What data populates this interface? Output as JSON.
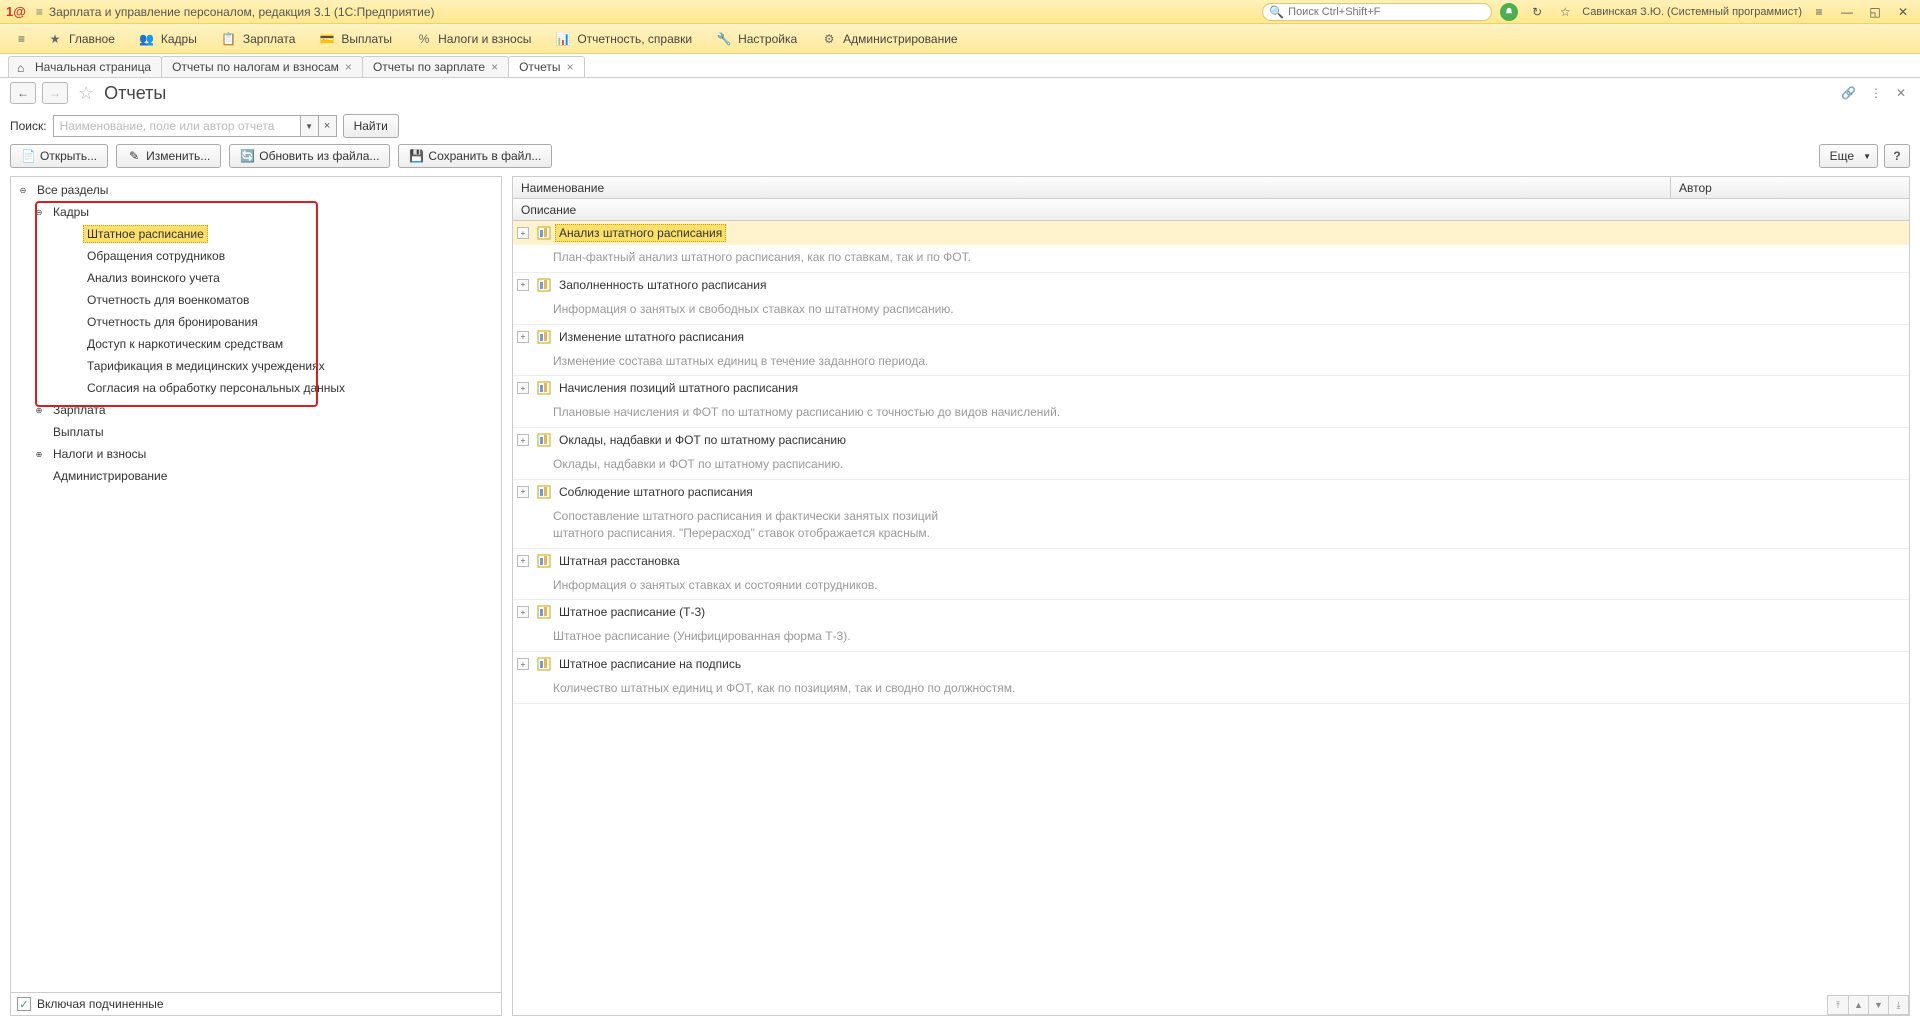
{
  "titlebar": {
    "app_title": "Зарплата и управление персоналом, редакция 3.1  (1С:Предприятие)",
    "search_placeholder": "Поиск Ctrl+Shift+F",
    "user": "Савинская З.Ю. (Системный программист)"
  },
  "mainmenu": [
    {
      "label": "Главное"
    },
    {
      "label": "Кадры"
    },
    {
      "label": "Зарплата"
    },
    {
      "label": "Выплаты"
    },
    {
      "label": "Налоги и взносы"
    },
    {
      "label": "Отчетность, справки"
    },
    {
      "label": "Настройка"
    },
    {
      "label": "Администрирование"
    }
  ],
  "tabs": [
    {
      "label": "Начальная страница",
      "home": true,
      "closeable": false,
      "active": false
    },
    {
      "label": "Отчеты по налогам и взносам",
      "closeable": true,
      "active": false
    },
    {
      "label": "Отчеты по зарплате",
      "closeable": true,
      "active": false
    },
    {
      "label": "Отчеты",
      "closeable": true,
      "active": true
    }
  ],
  "page": {
    "title": "Отчеты"
  },
  "search": {
    "label": "Поиск:",
    "placeholder": "Наименование, поле или автор отчета",
    "find_btn": "Найти"
  },
  "toolbar": {
    "open": "Открыть...",
    "edit": "Изменить...",
    "refresh": "Обновить из файла...",
    "save": "Сохранить в файл...",
    "more": "Еще"
  },
  "tree": {
    "root": "Все разделы",
    "items": [
      {
        "label": "Кадры",
        "expanded": true,
        "children": [
          {
            "label": "Штатное расписание",
            "selected": true
          },
          {
            "label": "Обращения сотрудников"
          },
          {
            "label": "Анализ воинского учета"
          },
          {
            "label": "Отчетность для военкоматов"
          },
          {
            "label": "Отчетность для бронирования"
          },
          {
            "label": "Доступ к наркотическим средствам"
          },
          {
            "label": "Тарификация в медицинских учреждениях"
          },
          {
            "label": "Согласия на обработку персональных данных"
          }
        ]
      },
      {
        "label": "Зарплата",
        "expandable": true
      },
      {
        "label": "Выплаты"
      },
      {
        "label": "Налоги и взносы",
        "expandable": true
      },
      {
        "label": "Администрирование"
      }
    ],
    "footer_check": "Включая подчиненные"
  },
  "grid": {
    "headers": {
      "name": "Наименование",
      "author": "Автор"
    },
    "subheader": "Описание",
    "rows": [
      {
        "name": "Анализ штатного расписания",
        "desc": "План-фактный анализ штатного расписания, как по ставкам, так и по ФОТ.",
        "selected": true
      },
      {
        "name": "Заполненность штатного расписания",
        "desc": "Информация о занятых и свободных ставках по штатному расписанию."
      },
      {
        "name": "Изменение штатного расписания",
        "desc": "Изменение состава штатных единиц в течение заданного периода."
      },
      {
        "name": "Начисления позиций штатного расписания",
        "desc": "Плановые начисления и ФОТ по штатному расписанию с точностью до видов начислений."
      },
      {
        "name": "Оклады, надбавки и ФОТ по штатному расписанию",
        "desc": "Оклады, надбавки и ФОТ по штатному расписанию."
      },
      {
        "name": "Соблюдение штатного расписания",
        "desc": "Сопоставление штатного расписания и фактически занятых позиций\nштатного расписания. \"Перерасход\" ставок отображается красным."
      },
      {
        "name": "Штатная расстановка",
        "desc": "Информация о занятых ставках и состоянии сотрудников."
      },
      {
        "name": "Штатное расписание (Т-3)",
        "desc": "Штатное расписание (Унифицированная форма Т-3)."
      },
      {
        "name": "Штатное расписание на подпись",
        "desc": "Количество штатных единиц и ФОТ, как по позициям, так и сводно по должностям."
      }
    ]
  }
}
